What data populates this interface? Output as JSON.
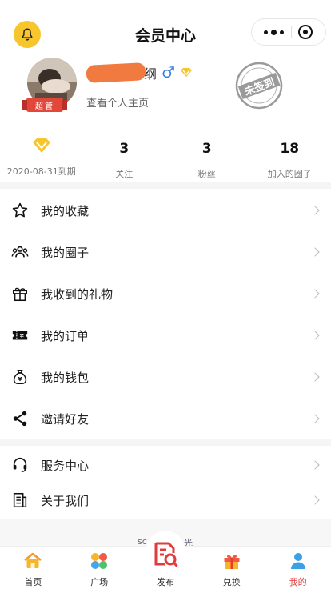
{
  "header": {
    "title": "会员中心",
    "bell_icon": "bell-icon",
    "more_icon": "more-dots-icon",
    "close_icon": "target-close-icon"
  },
  "profile": {
    "username_visible": "纲",
    "gender_symbol": "♂",
    "role_badge": "超管",
    "subtitle": "查看个人主页",
    "stamp_text": "未签到",
    "accent": "#f07a3f"
  },
  "stats": [
    {
      "value": "",
      "label": "2020-08-31到期",
      "icon": "vip-diamond-icon"
    },
    {
      "value": "3",
      "label": "关注"
    },
    {
      "value": "3",
      "label": "粉丝"
    },
    {
      "value": "18",
      "label": "加入的圈子"
    }
  ],
  "menu": {
    "group1": [
      {
        "label": "我的收藏",
        "icon": "star-icon"
      },
      {
        "label": "我的圈子",
        "icon": "group-icon"
      },
      {
        "label": "我收到的礼物",
        "icon": "gift-icon"
      },
      {
        "label": "我的订单",
        "icon": "ticket-icon"
      },
      {
        "label": "我的钱包",
        "icon": "money-bag-icon"
      },
      {
        "label": "邀请好友",
        "icon": "share-icon"
      }
    ],
    "group2": [
      {
        "label": "服务中心",
        "icon": "headset-icon"
      },
      {
        "label": "关于我们",
        "icon": "document-icon"
      }
    ]
  },
  "footer_peek": {
    "left": "sc",
    "right": "光"
  },
  "tabs": [
    {
      "label": "首页",
      "icon": "home-icon"
    },
    {
      "label": "广场",
      "icon": "square-grid-icon"
    },
    {
      "label": "发布",
      "icon": "publish-icon"
    },
    {
      "label": "兑换",
      "icon": "gift-box-icon"
    },
    {
      "label": "我的",
      "icon": "user-icon",
      "active": true
    }
  ],
  "colors": {
    "active_tab": "#e03a3a",
    "vip_gold": "#f7c52c",
    "bell_bg": "#f7c52c"
  }
}
